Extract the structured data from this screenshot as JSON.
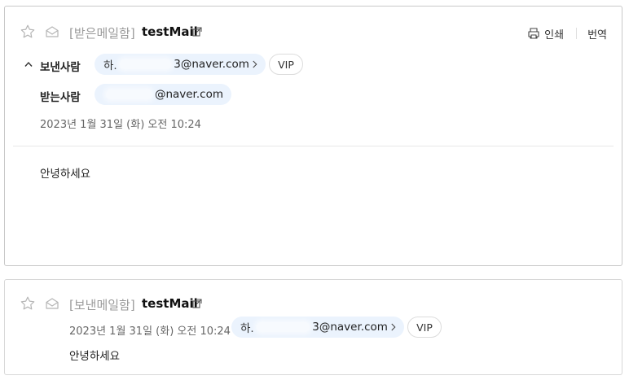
{
  "mail1": {
    "folder": "[받은메일함]",
    "subject": "testMail",
    "actions": {
      "print": "인쇄",
      "translate": "번역"
    },
    "sender_label": "보낸사람",
    "sender_prefix": "하.",
    "sender_domain": "3@naver.com",
    "recipient_label": "받는사람",
    "recipient_domain": "@naver.com",
    "vip": "VIP",
    "date": "2023년 1월 31일 (화) 오전 10:24",
    "body": "안녕하세요"
  },
  "mail2": {
    "folder": "[보낸메일함]",
    "subject": "testMail",
    "date": "2023년 1월 31일 (화) 오전 10:24",
    "sender_prefix": "하.",
    "sender_domain": "3@naver.com",
    "vip": "VIP",
    "body": "안녕하세요"
  }
}
